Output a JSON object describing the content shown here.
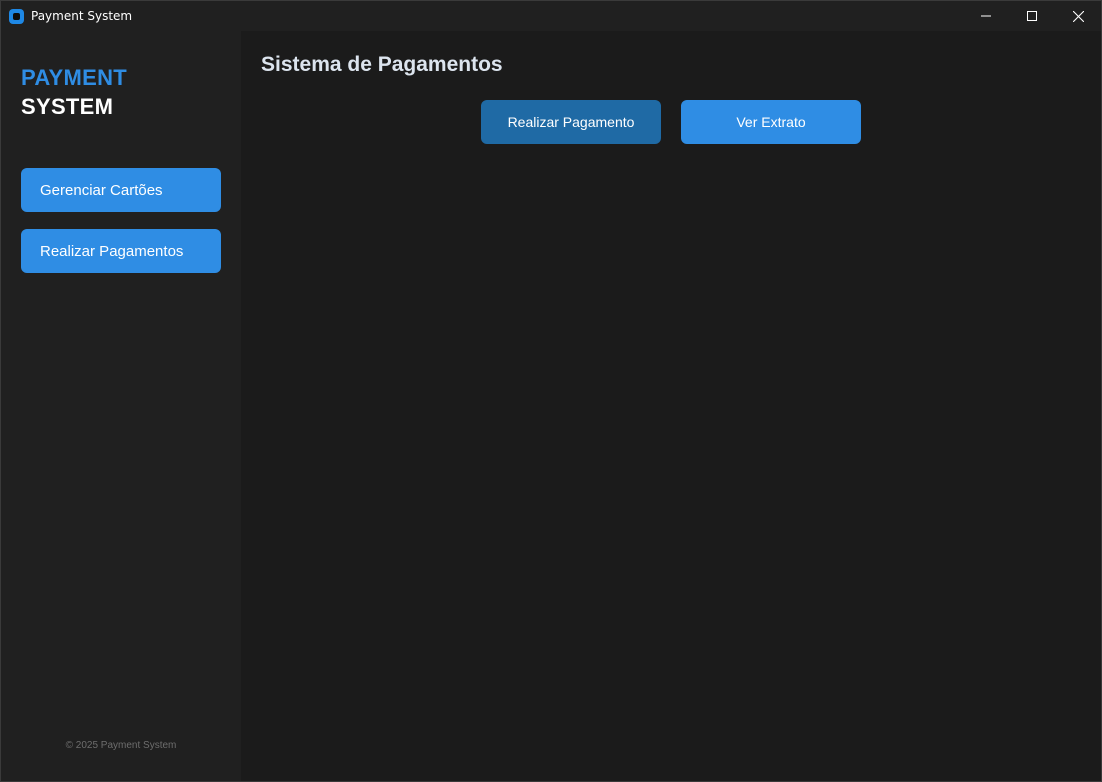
{
  "window": {
    "title": "Payment System",
    "controls": {
      "minimize_icon": "minimize-icon",
      "maximize_icon": "maximize-icon",
      "close_icon": "close-icon"
    }
  },
  "sidebar": {
    "logo_line1": "PAYMENT",
    "logo_line2": "SYSTEM",
    "items": [
      {
        "label": "Gerenciar Cartões"
      },
      {
        "label": "Realizar Pagamentos"
      }
    ],
    "footer": "© 2025 Payment System"
  },
  "main": {
    "title": "Sistema de Pagamentos",
    "buttons": {
      "pay": "Realizar Pagamento",
      "statement": "Ver Extrato"
    }
  },
  "colors": {
    "accent": "#2f8de4",
    "accent_pressed": "#1f6aa5",
    "sidebar_bg": "#202020",
    "main_bg": "#1b1b1b"
  }
}
